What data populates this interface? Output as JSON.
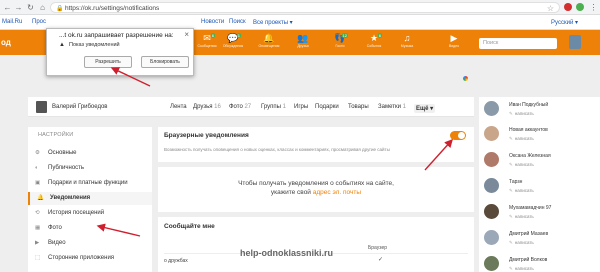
{
  "browser": {
    "url": "https://ok.ru/settings/notifications",
    "bookmarks": [
      "Mail.Ru",
      "Прос",
      "Новости",
      "Поиск",
      "Все проекты ▾"
    ],
    "lang": "Русский ▾"
  },
  "popup": {
    "title": "...t ok.ru запрашивает разрешение на:",
    "message": "Показ уведомлений",
    "allow": "Разрешить",
    "block": "Блокировать",
    "close": "×"
  },
  "topbar": {
    "logo": "од",
    "icons": [
      {
        "label": "Сообщения",
        "badge": "6"
      },
      {
        "label": "Обсуждения",
        "badge": "1"
      },
      {
        "label": "Оповещения",
        "badge": ""
      },
      {
        "label": "Друзья",
        "badge": ""
      },
      {
        "label": "Гости",
        "badge": "12"
      },
      {
        "label": "События",
        "badge": "6"
      },
      {
        "label": "Музыка",
        "badge": ""
      },
      {
        "label": "Видео",
        "badge": ""
      }
    ],
    "search_placeholder": "Поиск"
  },
  "profile": {
    "name": "Валерий Грибоедов",
    "tabs": [
      {
        "label": "Лента",
        "count": ""
      },
      {
        "label": "Друзья",
        "count": "16"
      },
      {
        "label": "Фото",
        "count": "27"
      },
      {
        "label": "Группы",
        "count": "1"
      },
      {
        "label": "Игры",
        "count": ""
      },
      {
        "label": "Подарки",
        "count": ""
      },
      {
        "label": "Товары",
        "count": ""
      },
      {
        "label": "Заметки",
        "count": "1"
      },
      {
        "label": "Ещё ▾",
        "count": ""
      }
    ]
  },
  "sidebar": {
    "heading": "НАСТРОЙКИ",
    "items": [
      {
        "icon": "⚙",
        "label": "Основные"
      },
      {
        "icon": "◐",
        "label": "Публичность"
      },
      {
        "icon": "▣",
        "label": "Подарки и платные функции"
      },
      {
        "icon": "🔔",
        "label": "Уведомления"
      },
      {
        "icon": "⟲",
        "label": "История посещений"
      },
      {
        "icon": "▦",
        "label": "Фото"
      },
      {
        "icon": "▶",
        "label": "Видео"
      },
      {
        "icon": "⬚",
        "label": "Сторонние приложения"
      }
    ]
  },
  "browser_notif": {
    "title": "Браузерные уведомления",
    "desc": "Возможность получать оповещения о новых оценках, классах и комментариях, просматривая другие сайты",
    "enabled": true
  },
  "email_card": {
    "line1": "Чтобы получать уведомления о событиях на сайте,",
    "line2_prefix": "укажите свой",
    "line2_link": "адрес эл. почты"
  },
  "messages_card": {
    "title": "Сообщайте мне",
    "column": "Браузер",
    "row": "о дружбах"
  },
  "watermark": "help-odnoklassniki.ru",
  "friends": [
    {
      "name": "Иван Подкубный",
      "action": "написать"
    },
    {
      "name": "Новая аккаунтов",
      "action": "написать"
    },
    {
      "name": "Оксана Железная",
      "action": "написать"
    },
    {
      "name": "Тарзн",
      "action": "написать"
    },
    {
      "name": "Мухамамадчин 97",
      "action": "написать"
    },
    {
      "name": "Дмитрий Мазаев",
      "action": "написать"
    },
    {
      "name": "Дмитрий Волков",
      "action": "написать"
    }
  ],
  "colors": {
    "accent": "#ee8208",
    "link": "#1a56b5",
    "arrow": "#d0202f"
  }
}
